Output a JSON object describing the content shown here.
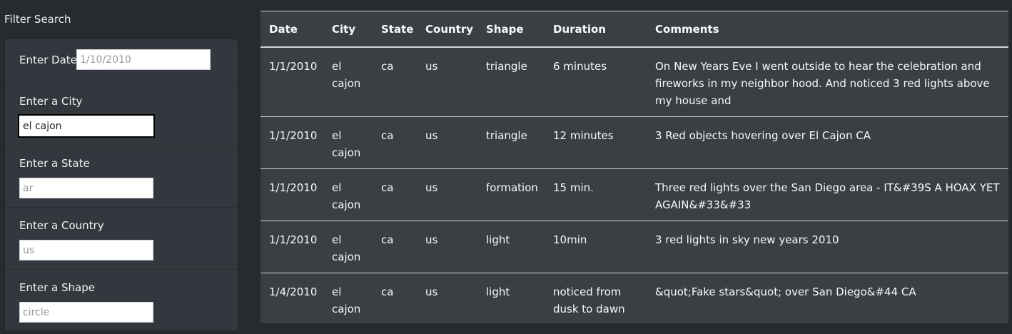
{
  "filter": {
    "title": "Filter Search",
    "fields": [
      {
        "label": "Enter Date",
        "value": "",
        "placeholder": "1/10/2010"
      },
      {
        "label": "Enter a City",
        "value": "el cajon",
        "placeholder": ""
      },
      {
        "label": "Enter a State",
        "value": "",
        "placeholder": "ar"
      },
      {
        "label": "Enter a Country",
        "value": "",
        "placeholder": "us"
      },
      {
        "label": "Enter a Shape",
        "value": "",
        "placeholder": "circle"
      }
    ]
  },
  "table": {
    "headers": [
      "Date",
      "City",
      "State",
      "Country",
      "Shape",
      "Duration",
      "Comments"
    ],
    "rows": [
      [
        "1/1/2010",
        "el cajon",
        "ca",
        "us",
        "triangle",
        "6 minutes",
        "On New Years Eve I went outside to hear the celebration and fireworks in my neighbor hood. And noticed 3 red lights above my house and"
      ],
      [
        "1/1/2010",
        "el cajon",
        "ca",
        "us",
        "triangle",
        "12 minutes",
        "3 Red objects hovering over El Cajon CA"
      ],
      [
        "1/1/2010",
        "el cajon",
        "ca",
        "us",
        "formation",
        "15 min.",
        "Three red lights over the San Diego area - IT&#39S A HOAX YET AGAIN&#33&#33"
      ],
      [
        "1/1/2010",
        "el cajon",
        "ca",
        "us",
        "light",
        "10min",
        "3 red lights in sky new years 2010"
      ],
      [
        "1/4/2010",
        "el cajon",
        "ca",
        "us",
        "light",
        "noticed from dusk to dawn",
        "&quot;Fake stars&quot; over San Diego&#44 CA"
      ]
    ]
  }
}
